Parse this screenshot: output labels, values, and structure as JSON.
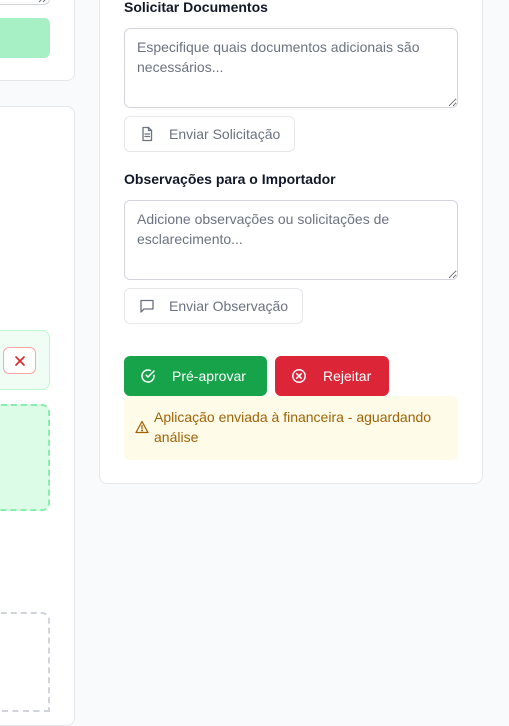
{
  "request_docs": {
    "label": "Solicitar Documentos",
    "placeholder": "Especifique quais documentos adicionais são necessários...",
    "button": "Enviar Solicitação"
  },
  "observations": {
    "label": "Observações para o Importador",
    "placeholder": "Adicione observações ou solicitações de esclarecimento...",
    "button": "Enviar Observação"
  },
  "actions": {
    "preapprove": "Pré-aprovar",
    "reject": "Rejeitar"
  },
  "status_alert": {
    "text": "Aplicação enviada à financeira - aguardando análise"
  },
  "colors": {
    "approve": "#16a34a",
    "reject": "#dc2638",
    "alert_bg": "#fefce8",
    "alert_text": "#a16207",
    "faded_green": "#a7f0c6",
    "upload_border": "#86efac"
  }
}
